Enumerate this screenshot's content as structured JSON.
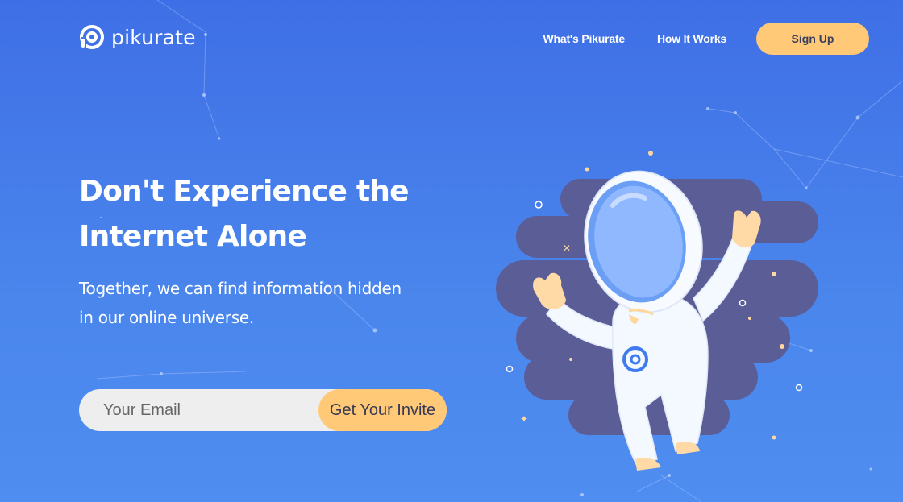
{
  "brand": {
    "name": "pikurate",
    "icon": "pikurate-logo-icon"
  },
  "nav": {
    "items": [
      {
        "label": "What's Pikurate"
      },
      {
        "label": "How It Works"
      }
    ],
    "signup_label": "Sign Up"
  },
  "hero": {
    "headline": "Don't Experience the Internet Alone",
    "subhead": "Together, we can find information hidden in our online universe.",
    "email_placeholder": "Your Email",
    "cta_label": "Get Your Invite"
  },
  "illustration": {
    "icon": "astronaut-illustration"
  },
  "colors": {
    "background": "#4178ea",
    "accent": "#ffc978",
    "cloud": "#5b5d96",
    "input_bg": "#eeeeee"
  }
}
